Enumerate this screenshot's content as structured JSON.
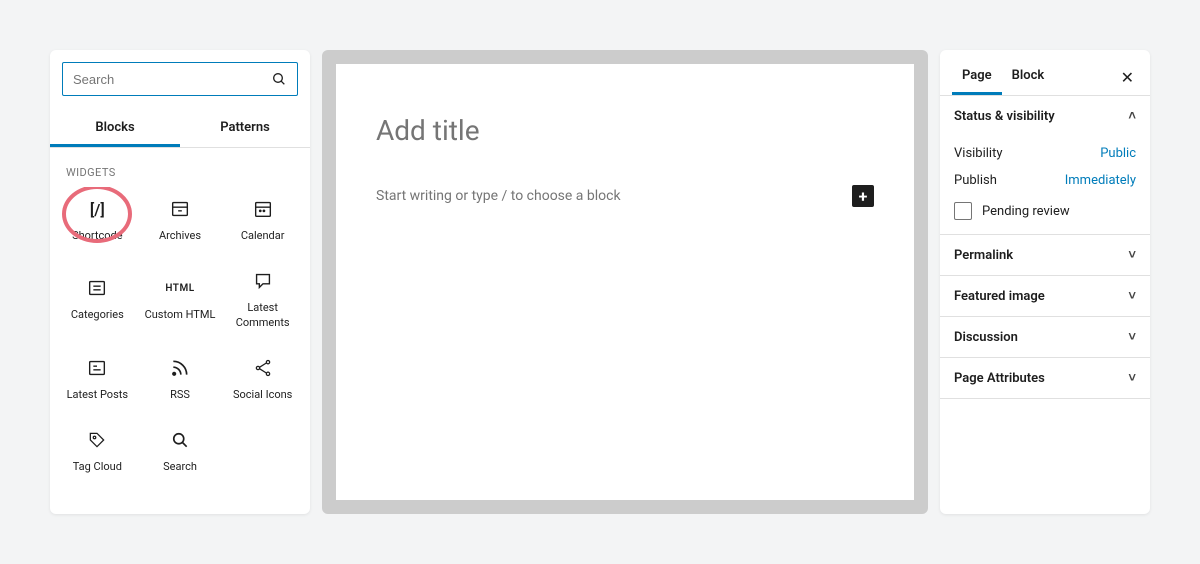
{
  "inserter": {
    "search_placeholder": "Search",
    "tabs": {
      "blocks": "Blocks",
      "patterns": "Patterns"
    },
    "section_label": "WIDGETS",
    "items": [
      {
        "id": "shortcode",
        "label": "Shortcode",
        "glyph": "[/]",
        "highlighted": true
      },
      {
        "id": "archives",
        "label": "Archives",
        "glyph": "svg-archive"
      },
      {
        "id": "calendar",
        "label": "Calendar",
        "glyph": "svg-calendar"
      },
      {
        "id": "categories",
        "label": "Categories",
        "glyph": "svg-categories"
      },
      {
        "id": "custom-html",
        "label": "Custom HTML",
        "glyph": "HTML"
      },
      {
        "id": "latest-comments",
        "label": "Latest Comments",
        "glyph": "svg-comment"
      },
      {
        "id": "latest-posts",
        "label": "Latest Posts",
        "glyph": "svg-post"
      },
      {
        "id": "rss",
        "label": "RSS",
        "glyph": "svg-rss"
      },
      {
        "id": "social",
        "label": "Social Icons",
        "glyph": "svg-share"
      },
      {
        "id": "tag-cloud",
        "label": "Tag Cloud",
        "glyph": "svg-tag"
      },
      {
        "id": "search",
        "label": "Search",
        "glyph": "svg-search"
      }
    ]
  },
  "canvas": {
    "title_placeholder": "Add title",
    "body_placeholder": "Start writing or type / to choose a block"
  },
  "settings": {
    "tabs": {
      "page": "Page",
      "block": "Block"
    },
    "status_section": {
      "title": "Status & visibility",
      "visibility_label": "Visibility",
      "visibility_value": "Public",
      "publish_label": "Publish",
      "publish_value": "Immediately",
      "pending_label": "Pending review"
    },
    "collapsed": [
      "Permalink",
      "Featured image",
      "Discussion",
      "Page Attributes"
    ]
  }
}
